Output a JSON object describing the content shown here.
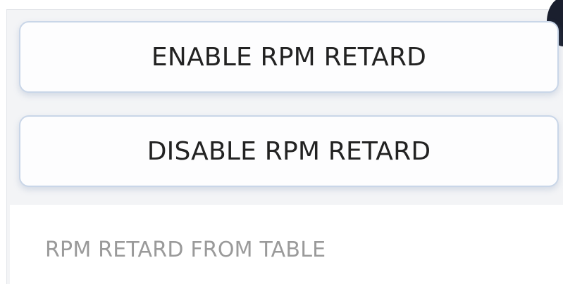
{
  "controls": {
    "enable_label": "ENABLE RPM RETARD",
    "disable_label": "DISABLE RPM RETARD",
    "table_option_label": "RPM RETARD FROM TABLE"
  },
  "theme": {
    "panel_background": "#f3f4f6",
    "button_border": "#c9d6e8",
    "button_text": "#222222",
    "muted_text": "#9a9a9a",
    "corner_indicator": "#1a1f2e"
  }
}
